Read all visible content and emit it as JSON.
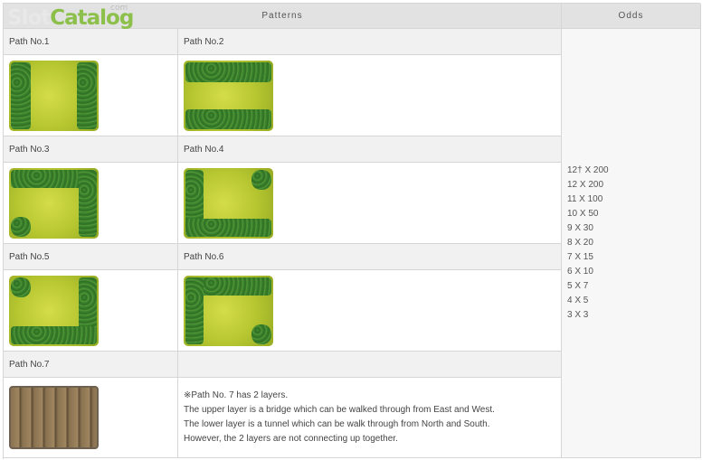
{
  "logo": {
    "part1": "Slot",
    "part2": "Catalog",
    "suffix": "com"
  },
  "header": {
    "patterns": "Patterns",
    "odds": "Odds"
  },
  "paths": [
    "Path No.1",
    "Path No.2",
    "Path No.3",
    "Path No.4",
    "Path No.5",
    "Path No.6",
    "Path No.7"
  ],
  "odds": [
    "12† X 200",
    "12 X 200",
    "11 X 100",
    "10 X 50",
    "9 X 30",
    "8 X 20",
    "7 X 15",
    "6 X 10",
    "5 X 7",
    "4 X 5",
    "3 X 3"
  ],
  "note": [
    "※Path No. 7 has 2 layers.",
    "The upper layer is a bridge which can be walked through from East and West.",
    "The lower layer is a tunnel which can be walk through from North and South.",
    "However, the 2 layers are not connecting up together."
  ]
}
